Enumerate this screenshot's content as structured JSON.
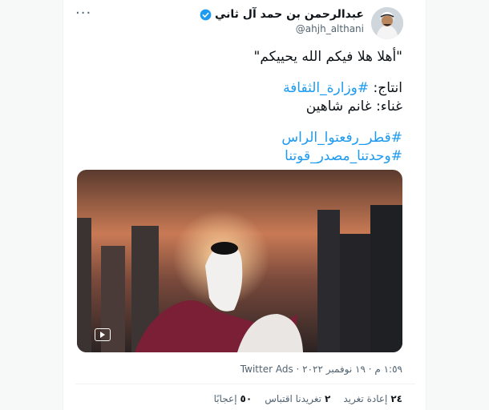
{
  "tweet": {
    "author_name": "عبدالرحمن بن حمد آل ثاني",
    "handle": "@ahjh_althani",
    "more_label": "···",
    "quote_line": "\"أهلا هلا فيكم الله يحييكم\"",
    "production_label": "انتاج:",
    "production_hashtag": "#وزارة_الثقافة",
    "singing_label": "غناء: غانم شاهين",
    "hashtag_1": "#قطر_رفعتوا_الراس",
    "hashtag_2": "#وحدتنا_مصدر_قوتنا",
    "meta": "١:٥٩ م · ١٩ نوفمبر ٢٠٢٢ · Twitter Ads",
    "stats": {
      "retweets_count": "٢٤",
      "retweets_label": "إعادة تغريد",
      "quotes_count": "٢",
      "quotes_label": "تغريدنا اقتباس",
      "likes_count": "٥٠",
      "likes_label": "إعجابًا"
    },
    "colors": {
      "hashtag": "#1d9bf0",
      "verified": "#1d9bf0",
      "secondary_text": "#536471"
    }
  }
}
